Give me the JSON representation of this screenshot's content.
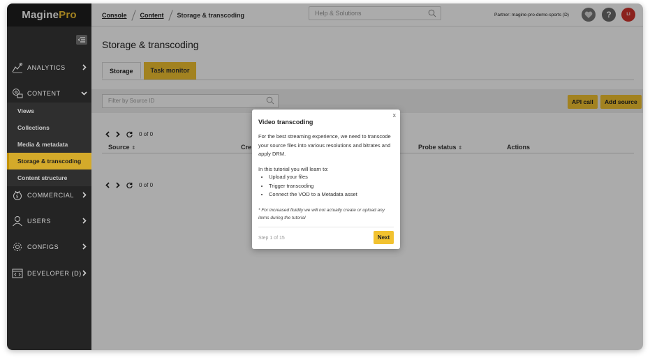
{
  "app": {
    "logo_main": "Magine",
    "logo_accent": "Pro"
  },
  "breadcrumb": {
    "items": [
      "Console",
      "Content",
      "Storage & transcoding"
    ]
  },
  "search": {
    "placeholder": "Help & Solutions"
  },
  "header": {
    "partner": "Partner: magine-pro-demo-sports (D)",
    "avatar_initials": "LI"
  },
  "sidebar": {
    "items": [
      {
        "label": "ANALYTICS",
        "icon": "analytics-icon"
      },
      {
        "label": "CONTENT",
        "icon": "content-icon"
      },
      {
        "label": "COMMERCIAL",
        "icon": "commercial-icon"
      },
      {
        "label": "USERS",
        "icon": "users-icon"
      },
      {
        "label": "CONFIGS",
        "icon": "configs-icon"
      },
      {
        "label": "DEVELOPER (D)",
        "icon": "developer-icon"
      }
    ],
    "content_subitems": [
      "Views",
      "Collections",
      "Media & metadata",
      "Storage & transcoding",
      "Content structure"
    ]
  },
  "main": {
    "title": "Storage & transcoding",
    "tabs": [
      "Storage",
      "Task monitor"
    ],
    "filter_placeholder": "Filter by Source ID",
    "api_call": "API call",
    "add_source": "Add source",
    "pager_text": "0 of 0",
    "columns": [
      "Source",
      "Cre",
      "Probe status",
      "Actions"
    ]
  },
  "modal": {
    "title": "Video transcoding",
    "close": "x",
    "intro": "For the best streaming experience, we need to transcode your source files into various resolutions and bitrates and apply DRM.",
    "learn_heading": "In this tutorial you will learn to:",
    "bullets": [
      "Upload your files",
      "Trigger transcoding",
      "Connect the VOD to a Metadata asset"
    ],
    "note": "* For increased fluidity we will not actually create or upload any items during the tutorial",
    "step": "Step 1 of 15",
    "next": "Next"
  },
  "colors": {
    "accent": "#f2c230",
    "sidebar_bg": "#2a2a2a",
    "avatar": "#d0342c"
  }
}
